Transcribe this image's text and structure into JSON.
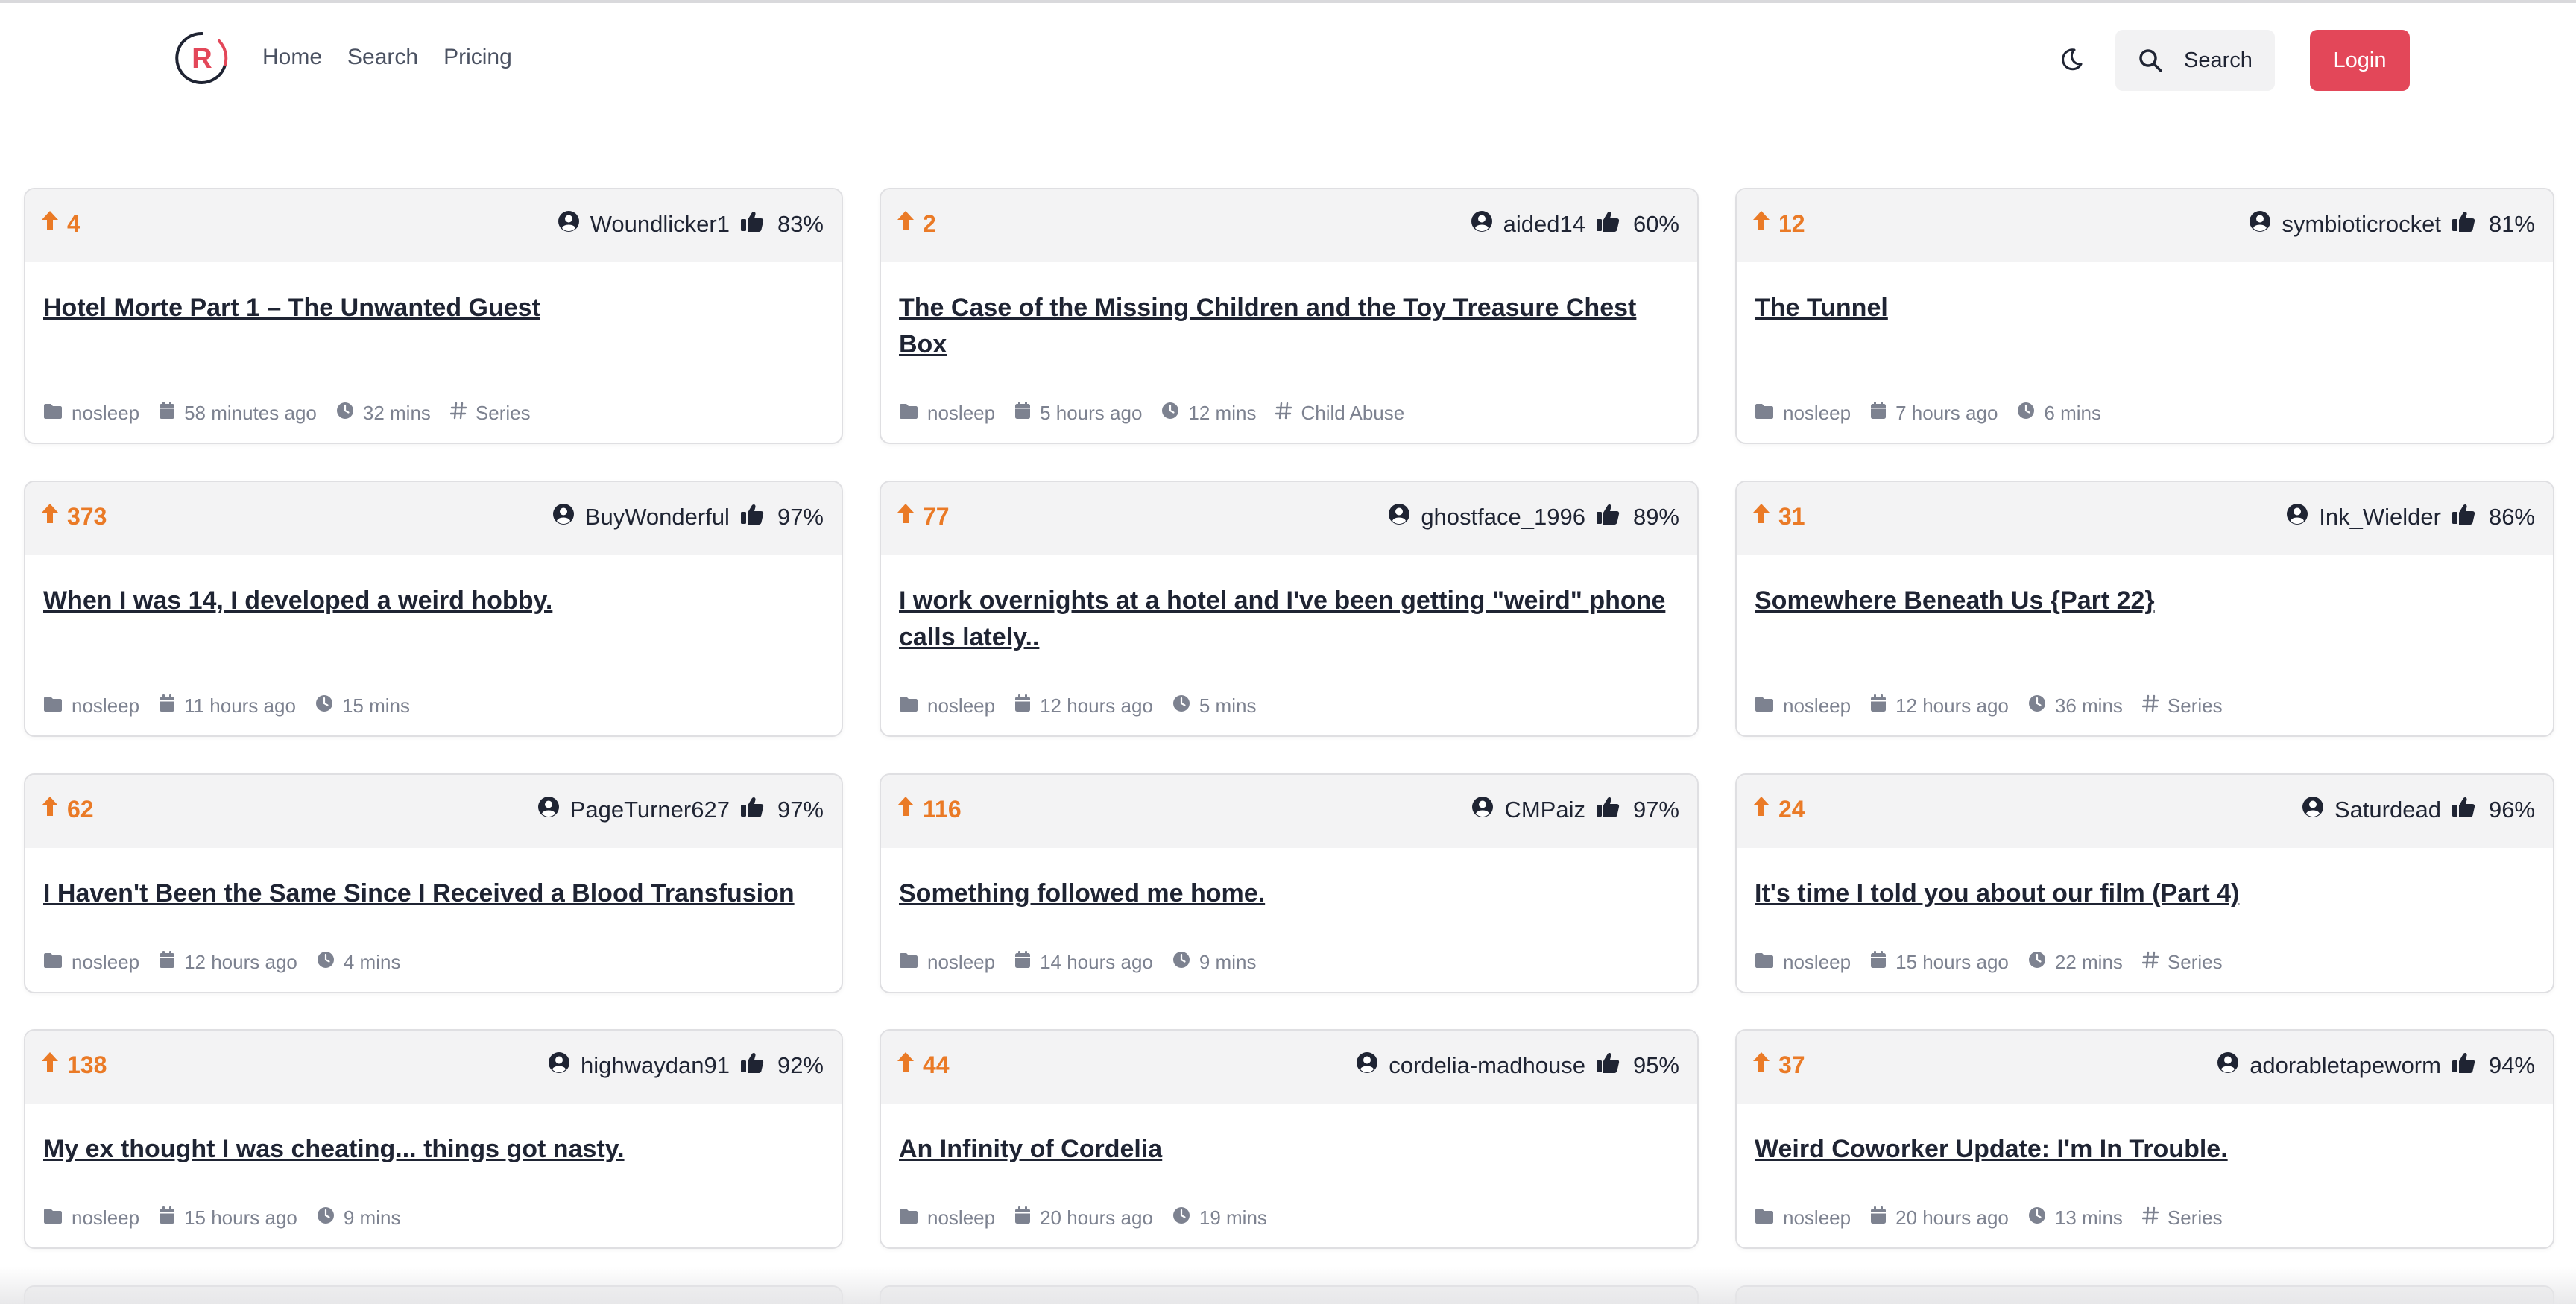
{
  "nav": {
    "links": [
      "Home",
      "Search",
      "Pricing"
    ],
    "search_label": "Search",
    "login_label": "Login",
    "logo_letter": "R"
  },
  "colors": {
    "accent": "#e34759",
    "upvote": "#ea7a26",
    "header_bg": "#f3f3f4"
  },
  "stories": [
    {
      "votes": "4",
      "author": "Woundlicker1",
      "rating": "83%",
      "title": "Hotel Morte Part 1 – The Unwanted Guest",
      "subreddit": "nosleep",
      "posted": "58 minutes ago",
      "read_time": "32 mins",
      "tag": "Series"
    },
    {
      "votes": "2",
      "author": "aided14",
      "rating": "60%",
      "title": "The Case of the Missing Children and the Toy Treasure Chest Box",
      "subreddit": "nosleep",
      "posted": "5 hours ago",
      "read_time": "12 mins",
      "tag": "Child Abuse"
    },
    {
      "votes": "12",
      "author": "symbioticrocket",
      "rating": "81%",
      "title": "The Tunnel",
      "subreddit": "nosleep",
      "posted": "7 hours ago",
      "read_time": "6 mins",
      "tag": ""
    },
    {
      "votes": "373",
      "author": "BuyWonderful",
      "rating": "97%",
      "title": "When I was 14, I developed a weird hobby.",
      "subreddit": "nosleep",
      "posted": "11 hours ago",
      "read_time": "15 mins",
      "tag": ""
    },
    {
      "votes": "77",
      "author": "ghostface_1996",
      "rating": "89%",
      "title": "I work overnights at a hotel and I've been getting \"weird\" phone calls lately..",
      "subreddit": "nosleep",
      "posted": "12 hours ago",
      "read_time": "5 mins",
      "tag": ""
    },
    {
      "votes": "31",
      "author": "Ink_Wielder",
      "rating": "86%",
      "title": "Somewhere Beneath Us {Part 22}",
      "subreddit": "nosleep",
      "posted": "12 hours ago",
      "read_time": "36 mins",
      "tag": "Series"
    },
    {
      "votes": "62",
      "author": "PageTurner627",
      "rating": "97%",
      "title": "I Haven't Been the Same Since I Received a Blood Transfusion",
      "subreddit": "nosleep",
      "posted": "12 hours ago",
      "read_time": "4 mins",
      "tag": ""
    },
    {
      "votes": "116",
      "author": "CMPaiz",
      "rating": "97%",
      "title": "Something followed me home.",
      "subreddit": "nosleep",
      "posted": "14 hours ago",
      "read_time": "9 mins",
      "tag": ""
    },
    {
      "votes": "24",
      "author": "Saturdead",
      "rating": "96%",
      "title": "It's time I told you about our film (Part 4)",
      "subreddit": "nosleep",
      "posted": "15 hours ago",
      "read_time": "22 mins",
      "tag": "Series"
    },
    {
      "votes": "138",
      "author": "highwaydan91",
      "rating": "92%",
      "title": "My ex thought I was cheating... things got nasty.",
      "subreddit": "nosleep",
      "posted": "15 hours ago",
      "read_time": "9 mins",
      "tag": ""
    },
    {
      "votes": "44",
      "author": "cordelia-madhouse",
      "rating": "95%",
      "title": "An Infinity of Cordelia",
      "subreddit": "nosleep",
      "posted": "20 hours ago",
      "read_time": "19 mins",
      "tag": ""
    },
    {
      "votes": "37",
      "author": "adorabletapeworm",
      "rating": "94%",
      "title": "Weird Coworker Update: I'm In Trouble.",
      "subreddit": "nosleep",
      "posted": "20 hours ago",
      "read_time": "13 mins",
      "tag": "Series"
    }
  ]
}
